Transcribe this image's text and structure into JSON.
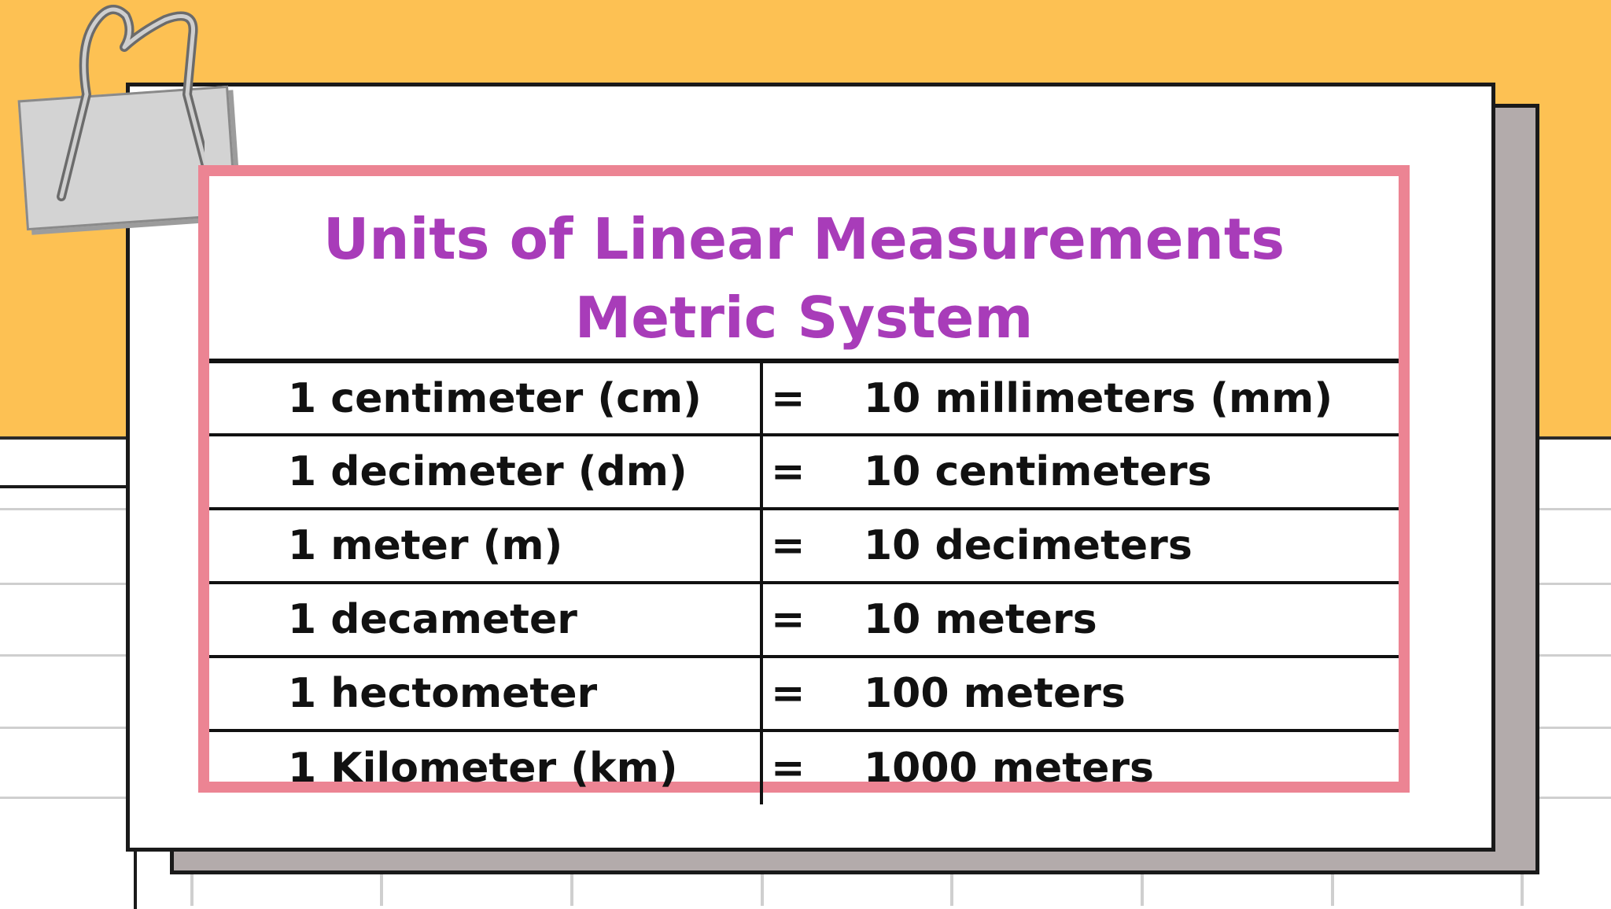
{
  "colors": {
    "background_top": "#FDC153",
    "card": "#FFFFFF",
    "card_shadow": "#B3ABAB",
    "frame_border": "#EC8493",
    "title_text": "#A83CB9",
    "table_text": "#111111"
  },
  "decor": {
    "clip_icon": "binder-clip-icon"
  },
  "title": {
    "line1": "Units of Linear Measurements",
    "line2": "Metric System"
  },
  "table": {
    "rows": [
      {
        "left": "1 centimeter (cm)",
        "eq": "=",
        "right": "10 millimeters (mm)"
      },
      {
        "left": "1 decimeter (dm)",
        "eq": "=",
        "right": "10 centimeters"
      },
      {
        "left": "1 meter (m)",
        "eq": "=",
        "right": "10 decimeters"
      },
      {
        "left": "1 decameter",
        "eq": "=",
        "right": "10 meters"
      },
      {
        "left": "1 hectometer",
        "eq": "=",
        "right": "100 meters"
      },
      {
        "left": "1 Kilometer (km)",
        "eq": "=",
        "right": "1000 meters"
      }
    ]
  }
}
